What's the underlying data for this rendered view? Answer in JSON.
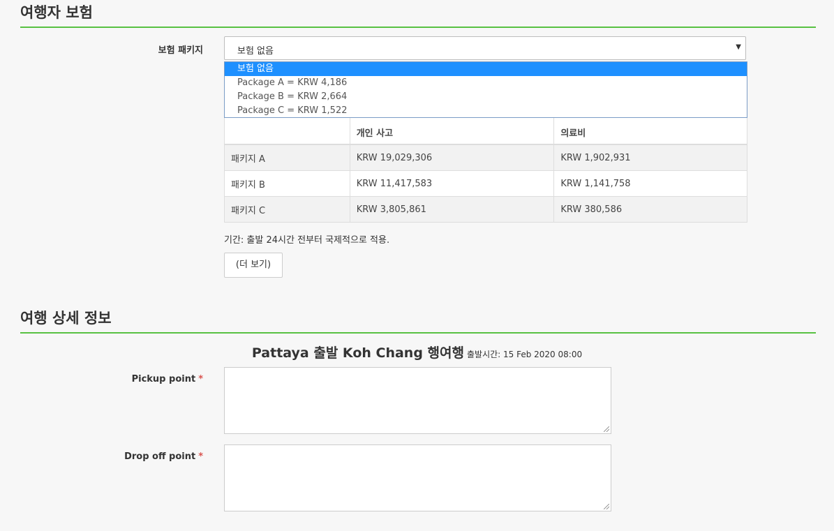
{
  "insurance_section": {
    "title": "여행자 보험",
    "package_label": "보험 패키지",
    "select": {
      "selected_value": "보험 없음",
      "options": [
        "보험 없음",
        "Package A = KRW 4,186",
        "Package B = KRW 2,664",
        "Package C = KRW 1,522"
      ]
    },
    "table": {
      "headers": [
        "",
        "개인 사고",
        "의료비"
      ],
      "rows": [
        [
          "패키지 A",
          "KRW 19,029,306",
          "KRW 1,902,931"
        ],
        [
          "패키지 B",
          "KRW 11,417,583",
          "KRW 1,141,758"
        ],
        [
          "패키지 C",
          "KRW 3,805,861",
          "KRW 380,586"
        ]
      ]
    },
    "period_text": "기간: 출발 24시간 전부터 국제적으로 적용.",
    "more_button_label": "(더 보기)"
  },
  "trip_section": {
    "title": "여행 상세 정보",
    "trip_title": "Pattaya 출발 Koh Chang 행여행",
    "departure_text": "출발시간: 15 Feb 2020 08:00",
    "pickup_label": "Pickup point",
    "dropoff_label": "Drop off point",
    "required_mark": "*"
  },
  "colors": {
    "section_underline": "#58c142",
    "selected_option": "#1e90ff",
    "required": "#d9534f"
  }
}
